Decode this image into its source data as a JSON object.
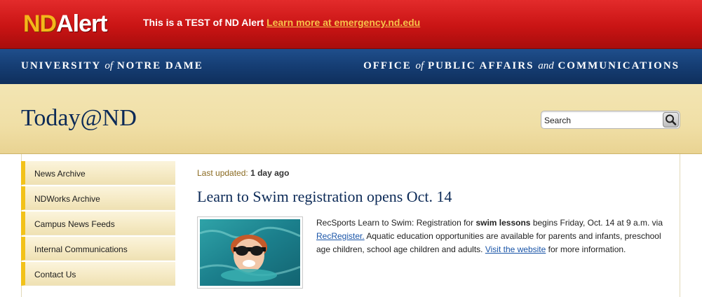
{
  "alert": {
    "logo_nd": "ND",
    "logo_alert": "Alert",
    "message": "This is a TEST of ND Alert",
    "link": "Learn more at emergency.nd.edu",
    "colors": {
      "bar": "#c91414",
      "logo_gold": "#f4b61a",
      "link": "#f6c24a"
    }
  },
  "identity": {
    "left_a": "UNIVERSITY",
    "left_of": "of",
    "left_b": "NOTRE DAME",
    "right_a": "OFFICE",
    "right_of": "of",
    "right_b": "PUBLIC AFFAIRS",
    "right_and": "and",
    "right_c": "COMMUNICATIONS",
    "color": "#153d73"
  },
  "header": {
    "title": "Today@ND",
    "search_value": "Search",
    "search_icon": "magnifier-icon",
    "background": "#f0dfa6"
  },
  "sidebar": {
    "items": [
      {
        "label": "News Archive"
      },
      {
        "label": "NDWorks Archive"
      },
      {
        "label": "Campus News Feeds"
      },
      {
        "label": "Internal Communications"
      },
      {
        "label": "Contact Us"
      }
    ],
    "accent": "#f2c21a"
  },
  "main": {
    "updated_label": "Last updated:",
    "updated_value": "1 day ago",
    "headline": "Learn to Swim registration opens Oct. 14",
    "story": {
      "t1": "RecSports Learn to Swim: Registration for ",
      "t1_bold": "swim lessons",
      "t2": " begins Friday, Oct. 14 at 9 a.m. via ",
      "link1": "RecRegister.",
      "t3": " Aquatic education opportunities are available for parents and infants, preschool age children, school age children and adults. ",
      "link2": "Visit the website",
      "t4": " for more information."
    }
  }
}
